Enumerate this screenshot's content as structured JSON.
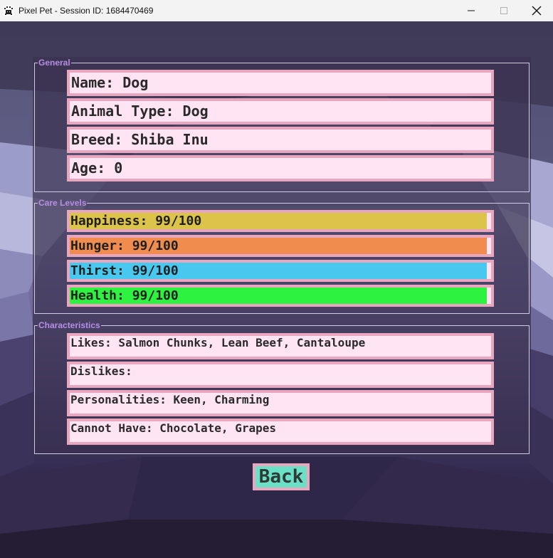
{
  "window": {
    "title": "Pixel Pet - Session ID: 1684470469",
    "app_icon": "pixel-pet-icon",
    "controls": [
      "minimize-icon",
      "maximize-icon",
      "close-icon"
    ]
  },
  "general": {
    "legend": "General",
    "fields": [
      {
        "text": "Name: Dog"
      },
      {
        "text": "Animal Type: Dog"
      },
      {
        "text": "Breed: Shiba Inu"
      },
      {
        "text": "Age: 0"
      }
    ]
  },
  "care": {
    "legend": "Care Levels",
    "bars": [
      {
        "text": "Happiness: 99/100",
        "value": 99,
        "max": 100,
        "color": "#dcc44a"
      },
      {
        "text": "Hunger: 99/100",
        "value": 99,
        "max": 100,
        "color": "#ef8c4e"
      },
      {
        "text": "Thirst: 99/100",
        "value": 99,
        "max": 100,
        "color": "#48c8ef"
      },
      {
        "text": "Health: 99/100",
        "value": 99,
        "max": 100,
        "color": "#2df23f"
      }
    ]
  },
  "characteristics": {
    "legend": "Characteristics",
    "fields": [
      {
        "text": "Likes: Salmon Chunks, Lean Beef, Cantaloupe"
      },
      {
        "text": "Dislikes:"
      },
      {
        "text": "Personalities: Keen, Charming"
      },
      {
        "text": "Cannot Have: Chocolate, Grapes"
      }
    ]
  },
  "back_button": {
    "label": "Back"
  },
  "colors": {
    "legend": "#b78ee6",
    "field_bg": "#ffe4f4",
    "field_border": "#e8a7bf",
    "back_bg": "#6ce0c6"
  }
}
